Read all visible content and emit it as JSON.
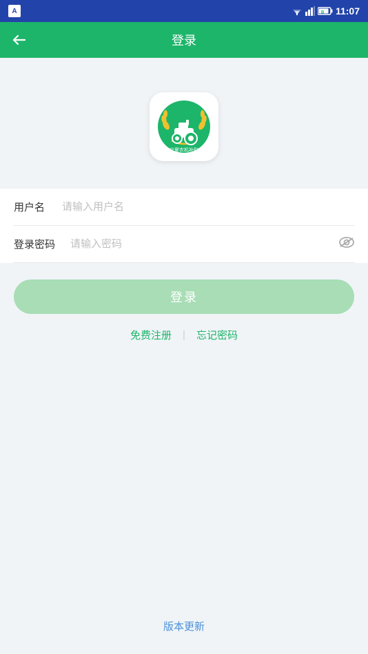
{
  "statusBar": {
    "time": "11:07",
    "appIcon": "A"
  },
  "appBar": {
    "title": "登录",
    "backIcon": "←"
  },
  "logo": {
    "altText": "宁夏农机补贴"
  },
  "form": {
    "usernamLabel": "用户名",
    "usernamePlaceholder": "请输入用户名",
    "passwordLabel": "登录密码",
    "passwordPlaceholder": "请输入密码"
  },
  "buttons": {
    "loginLabel": "登录",
    "registerLabel": "免费注册",
    "forgotLabel": "忘记密码",
    "versionLabel": "版本更新"
  }
}
